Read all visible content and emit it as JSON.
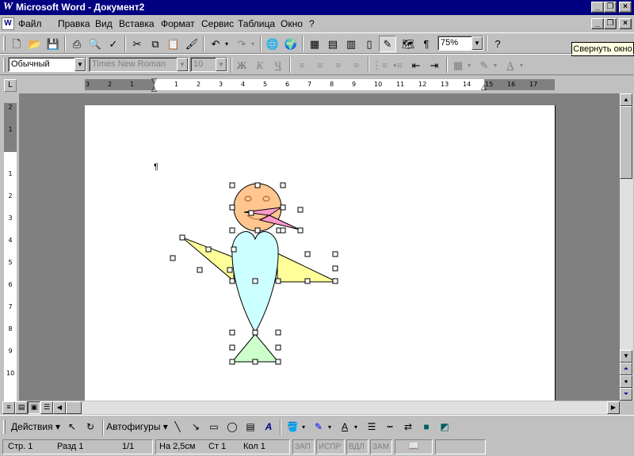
{
  "window": {
    "title": "Microsoft Word - Документ2",
    "app_icon": "word-w-icon"
  },
  "menu": {
    "items": [
      {
        "label": "Файл"
      },
      {
        "label": "Правка"
      },
      {
        "label": "Вид"
      },
      {
        "label": "Вставка"
      },
      {
        "label": "Формат"
      },
      {
        "label": "Сервис"
      },
      {
        "label": "Таблица"
      },
      {
        "label": "Окно"
      },
      {
        "label": "?"
      }
    ]
  },
  "standard_toolbar": {
    "zoom": "75%",
    "tooltip": "Свернуть окно"
  },
  "formatting_toolbar": {
    "style": "Обычный",
    "font": "Times New Roman",
    "size": "10",
    "bold": "Ж",
    "italic": "К",
    "underline": "Ч"
  },
  "ruler": {
    "h_ticks": [
      "3",
      "2",
      "1",
      "1",
      "2",
      "3",
      "4",
      "5",
      "6",
      "7",
      "8",
      "9",
      "10",
      "11",
      "12",
      "13",
      "14",
      "15",
      "16",
      "17"
    ],
    "v_ticks": [
      "2",
      "1",
      "1",
      "2",
      "3",
      "4",
      "5",
      "6",
      "7",
      "8",
      "9",
      "10"
    ]
  },
  "document": {
    "pilcrow": "¶"
  },
  "drawing_toolbar": {
    "actions": "Действия",
    "autoshapes": "Автофигуры"
  },
  "status": {
    "page": "Стр. 1",
    "section": "Разд 1",
    "pages": "1/1",
    "at": "На 2,5см",
    "line": "Ст 1",
    "col": "Кол 1",
    "rec": "ЗАП",
    "trk": "ИСПР",
    "ext": "ВДЛ",
    "ovr": "ЗАМ"
  },
  "colors": {
    "titlebar": "#000080",
    "head": "#ffc78f",
    "body": "#ccffff",
    "wings": "#ffff99",
    "feet": "#ccffcc",
    "beak": "#ff99cc"
  }
}
